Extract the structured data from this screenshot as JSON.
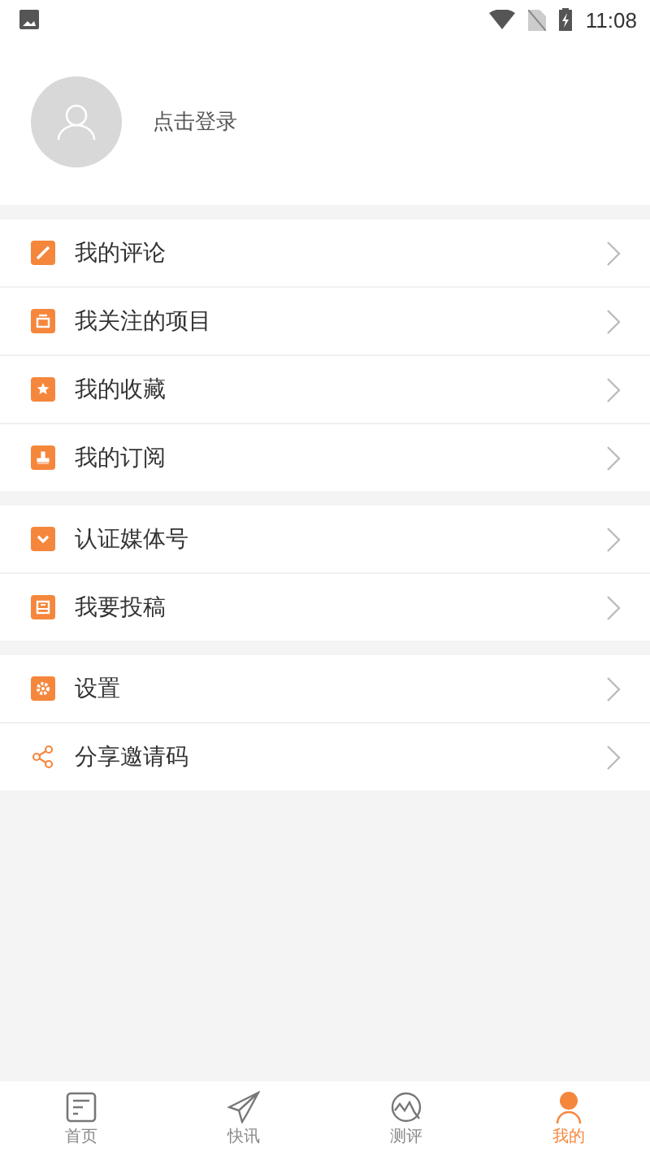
{
  "status_bar": {
    "time": "11:08"
  },
  "profile": {
    "login_text": "点击登录"
  },
  "menu_sections": [
    {
      "items": [
        {
          "label": "我的评论"
        },
        {
          "label": "我关注的项目"
        },
        {
          "label": "我的收藏"
        },
        {
          "label": "我的订阅"
        }
      ]
    },
    {
      "items": [
        {
          "label": "认证媒体号"
        },
        {
          "label": "我要投稿"
        }
      ]
    },
    {
      "items": [
        {
          "label": "设置"
        },
        {
          "label": "分享邀请码"
        }
      ]
    }
  ],
  "tab_bar": [
    {
      "label": "首页",
      "selected": false
    },
    {
      "label": "快讯",
      "selected": false
    },
    {
      "label": "测评",
      "selected": false
    },
    {
      "label": "我的",
      "selected": true
    }
  ]
}
